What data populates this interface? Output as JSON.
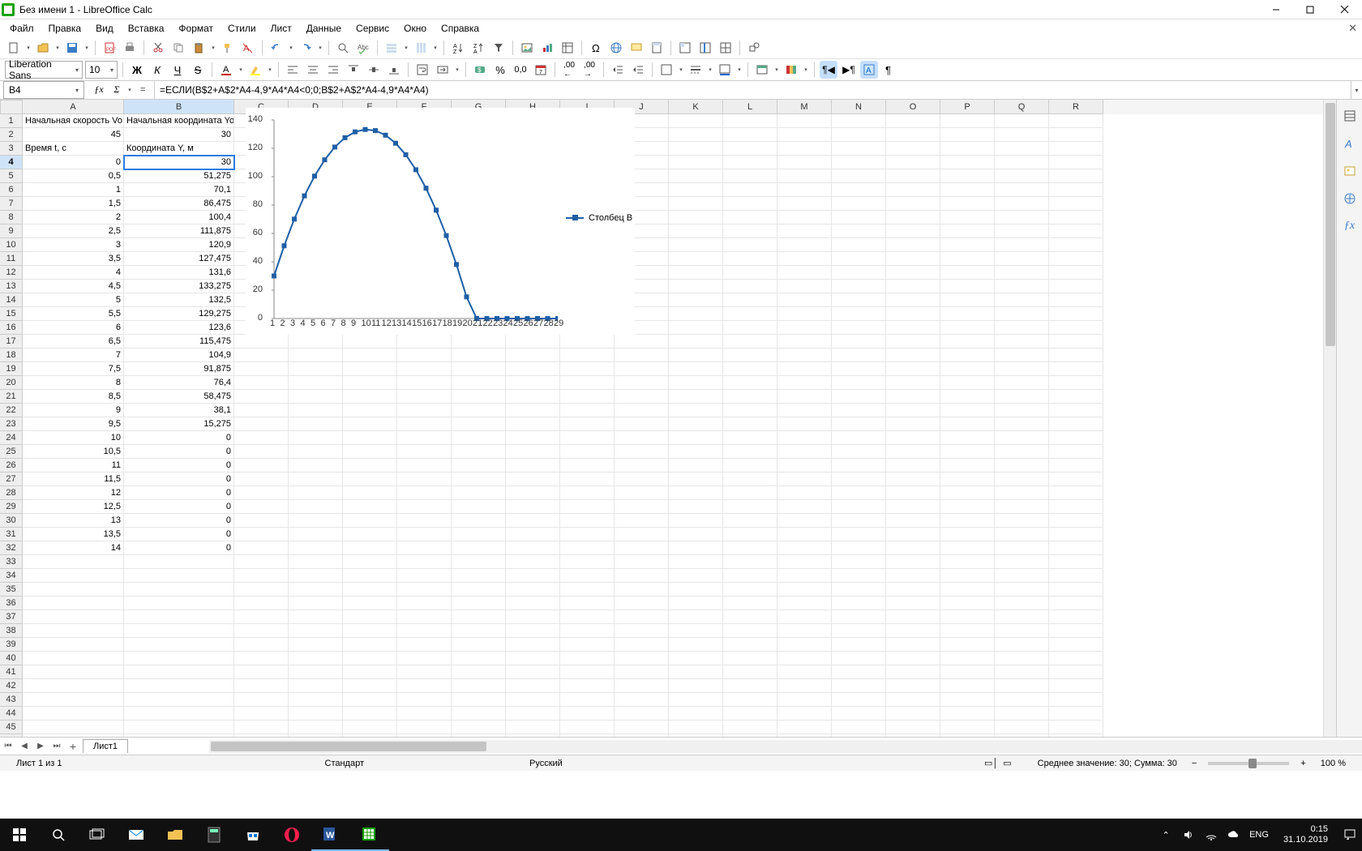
{
  "window": {
    "title": "Без имени 1 - LibreOffice Calc"
  },
  "menu": [
    "Файл",
    "Правка",
    "Вид",
    "Вставка",
    "Формат",
    "Стили",
    "Лист",
    "Данные",
    "Сервис",
    "Окно",
    "Справка"
  ],
  "fmt": {
    "font": "Liberation Sans",
    "size": "10"
  },
  "formula_bar": {
    "cell_ref": "B4",
    "formula": "=ЕСЛИ(B$2+A$2*A4-4,9*A4*A4<0;0;B$2+A$2*A4-4,9*A4*A4)"
  },
  "columns": [
    "A",
    "B",
    "C",
    "D",
    "E",
    "F",
    "G",
    "H",
    "I",
    "J",
    "K",
    "L",
    "M",
    "N",
    "O",
    "P",
    "Q",
    "R"
  ],
  "data_cells": {
    "A1": "Начальная скорость Vo",
    "B1": "Начальная координата Yo",
    "A2": "45",
    "B2": "30",
    "A3": "Время t, с",
    "B3": "Координата Y, м"
  },
  "col_a_from_4": [
    "0",
    "0,5",
    "1",
    "1,5",
    "2",
    "2,5",
    "3",
    "3,5",
    "4",
    "4,5",
    "5",
    "5,5",
    "6",
    "6,5",
    "7",
    "7,5",
    "8",
    "8,5",
    "9",
    "9,5",
    "10",
    "10,5",
    "11",
    "11,5",
    "12",
    "12,5",
    "13",
    "13,5",
    "14"
  ],
  "col_b_from_4": [
    "30",
    "51,275",
    "70,1",
    "86,475",
    "100,4",
    "111,875",
    "120,9",
    "127,475",
    "131,6",
    "133,275",
    "132,5",
    "129,275",
    "123,6",
    "115,475",
    "104,9",
    "91,875",
    "76,4",
    "58,475",
    "38,1",
    "15,275",
    "0",
    "0",
    "0",
    "0",
    "0",
    "0",
    "0",
    "0",
    "0"
  ],
  "chart_data": {
    "type": "line",
    "series": [
      {
        "name": "Столбец B",
        "values": [
          30,
          51.275,
          70.1,
          86.475,
          100.4,
          111.875,
          120.9,
          127.475,
          131.6,
          133.275,
          132.5,
          129.275,
          123.6,
          115.475,
          104.9,
          91.875,
          76.4,
          58.475,
          38.1,
          15.275,
          0,
          0,
          0,
          0,
          0,
          0,
          0,
          0,
          0
        ]
      }
    ],
    "categories": [
      "1",
      "2",
      "3",
      "4",
      "5",
      "6",
      "7",
      "8",
      "9",
      "10",
      "11",
      "12",
      "13",
      "14",
      "15",
      "16",
      "17",
      "18",
      "19",
      "20",
      "21",
      "22",
      "23",
      "24",
      "25",
      "26",
      "27",
      "28",
      "29"
    ],
    "y_ticks": [
      0,
      20,
      40,
      60,
      80,
      100,
      120,
      140
    ],
    "ylim": [
      0,
      140
    ]
  },
  "legend": "Столбец B",
  "sheet_tabs": {
    "active": "Лист1"
  },
  "status": {
    "sheet": "Лист 1 из 1",
    "style": "Стандарт",
    "lang": "Русский",
    "summary": "Среднее значение: 30; Сумма: 30",
    "zoom": "100 %"
  },
  "taskbar": {
    "lang": "ENG",
    "time": "0:15",
    "date": "31.10.2019"
  }
}
